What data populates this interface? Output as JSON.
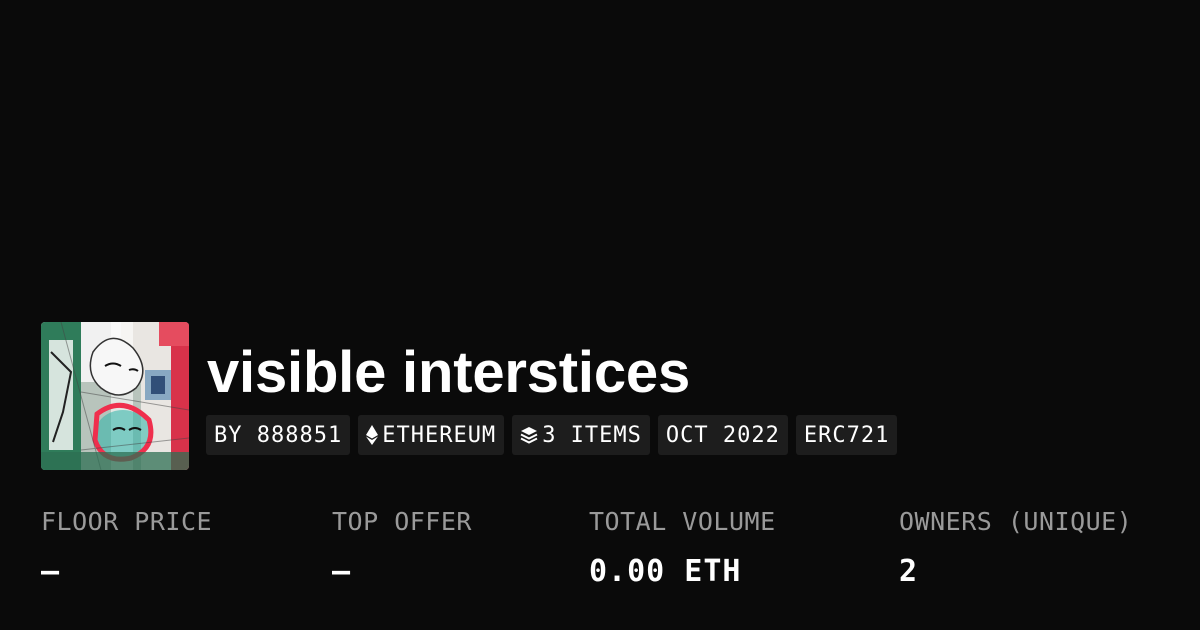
{
  "collection": {
    "title": "visible interstices",
    "badges": {
      "creator": "BY 888851",
      "chain": "ETHEREUM",
      "items": "3 ITEMS",
      "date": "OCT 2022",
      "standard": "ERC721"
    },
    "icons": {
      "chain": "ethereum-icon",
      "items": "layers-icon"
    }
  },
  "stats": {
    "floor_price": {
      "label": "FLOOR PRICE",
      "value": "—"
    },
    "top_offer": {
      "label": "TOP OFFER",
      "value": "—"
    },
    "total_volume": {
      "label": "TOTAL VOLUME",
      "value": "0.00 ETH"
    },
    "owners": {
      "label": "OWNERS (UNIQUE)",
      "value": "2"
    }
  },
  "colors": {
    "background": "#0a0a0a",
    "badge_background": "#1d1d1d",
    "label_text": "#9a9a9a",
    "value_text": "#ffffff"
  }
}
